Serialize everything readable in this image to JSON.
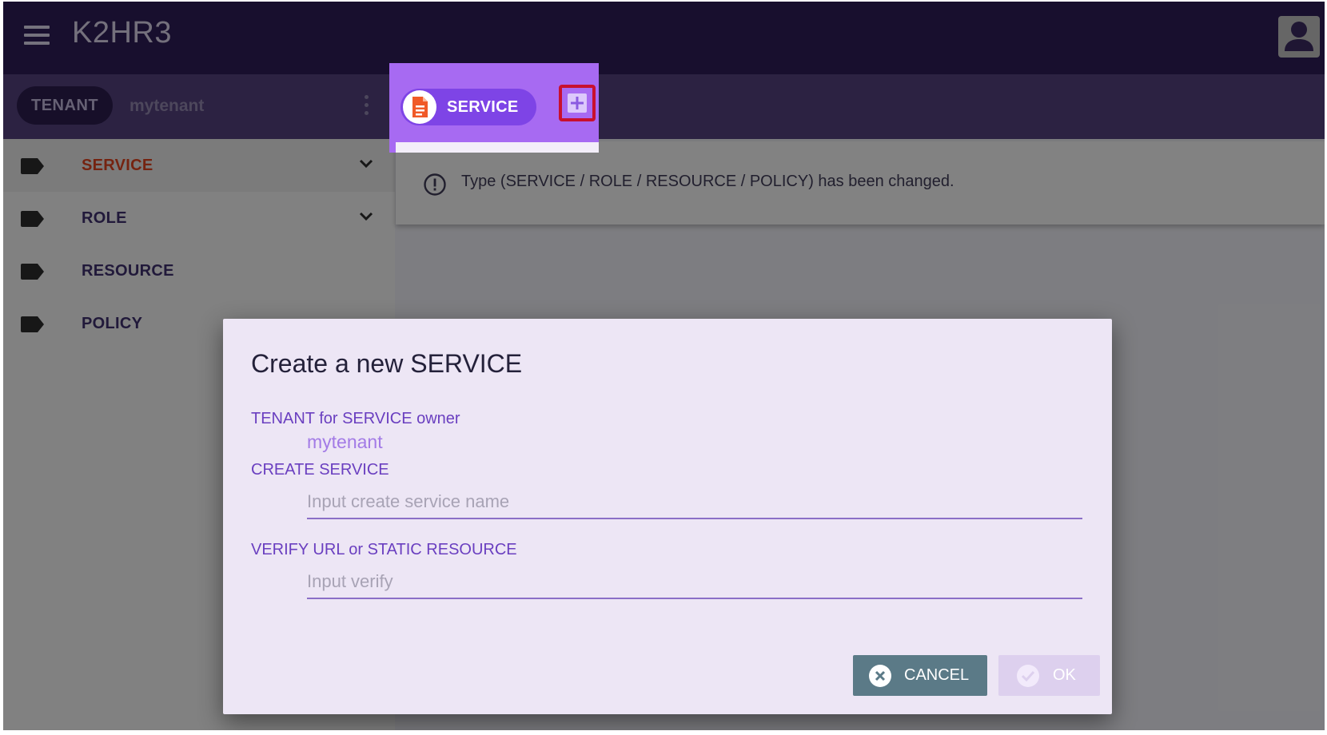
{
  "app": {
    "title": "K2HR3",
    "menu_icon": "menu-icon",
    "account_icon": "account-icon"
  },
  "tenant_bar": {
    "chip_label": "TENANT",
    "tenant_name": "mytenant"
  },
  "service_toolbar": {
    "chip_label": "SERVICE",
    "chip_icon": "document-icon",
    "add_icon": "add-icon"
  },
  "sidebar": {
    "items": [
      {
        "label": "SERVICE",
        "icon": "label-icon",
        "expandable": true,
        "active": true
      },
      {
        "label": "ROLE",
        "icon": "label-icon",
        "expandable": true,
        "active": false
      },
      {
        "label": "RESOURCE",
        "icon": "label-icon",
        "expandable": false,
        "active": false
      },
      {
        "label": "POLICY",
        "icon": "label-icon",
        "expandable": false,
        "active": false
      }
    ]
  },
  "notice": {
    "icon": "info-circle-icon",
    "text": "Type (SERVICE / ROLE / RESOURCE / POLICY) has been changed."
  },
  "dialog": {
    "title": "Create a new SERVICE",
    "owner_label": "TENANT for SERVICE owner",
    "owner_value": "mytenant",
    "service_label": "CREATE SERVICE",
    "service_placeholder": "Input create service name",
    "service_value": "",
    "verify_label": "VERIFY URL or STATIC RESOURCE",
    "verify_placeholder": "Input verify",
    "verify_value": "",
    "cancel_label": "CANCEL",
    "ok_label": "OK"
  },
  "colors": {
    "app_bar": "#2e1c55",
    "tenant_bar": "#52407a",
    "accent": "#7e44e6",
    "highlight_border": "#c8102e",
    "active_sidebar_text": "#d9411e",
    "dialog_bg": "#ede6f5",
    "cancel_button": "#5b7a87"
  }
}
